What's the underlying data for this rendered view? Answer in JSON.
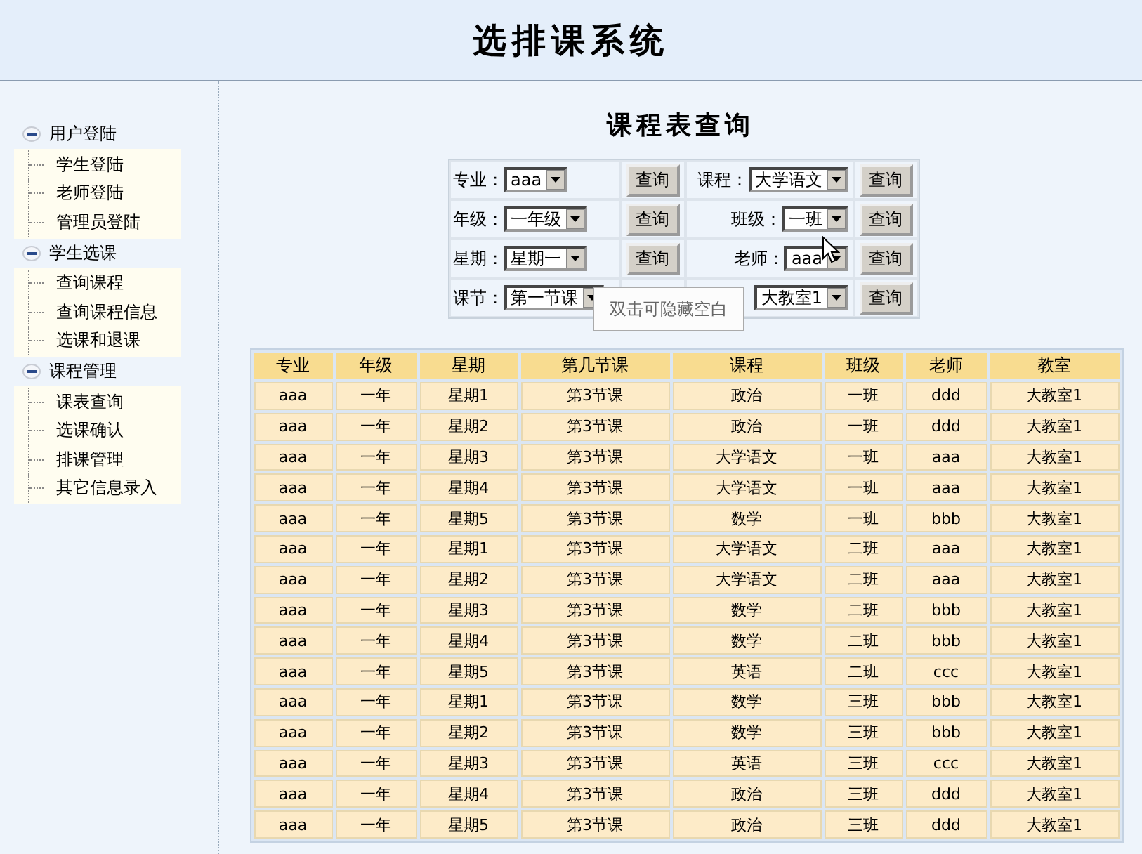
{
  "header": {
    "title": "选排课系统"
  },
  "sidebar": {
    "groups": [
      {
        "label": "用户登陆",
        "expanded": true,
        "children": [
          {
            "label": "学生登陆"
          },
          {
            "label": "老师登陆"
          },
          {
            "label": "管理员登陆"
          }
        ]
      },
      {
        "label": "学生选课",
        "expanded": true,
        "children": [
          {
            "label": "查询课程"
          },
          {
            "label": "查询课程信息"
          },
          {
            "label": "选课和退课"
          }
        ]
      },
      {
        "label": "课程管理",
        "expanded": true,
        "children": [
          {
            "label": "课表查询"
          },
          {
            "label": "选课确认"
          },
          {
            "label": "排课管理"
          },
          {
            "label": "其它信息录入"
          }
        ]
      }
    ]
  },
  "main": {
    "title": "课程表查询",
    "query_form": {
      "rows": [
        {
          "fields": [
            {
              "label": "专业：",
              "value": "aaa",
              "button": "查询"
            },
            {
              "label": "课程：",
              "value": "大学语文",
              "button": "查询"
            }
          ]
        },
        {
          "fields": [
            {
              "label": "年级：",
              "value": "一年级",
              "button": "查询"
            },
            {
              "label": "班级：",
              "value": "一班",
              "button": "查询"
            }
          ]
        },
        {
          "fields": [
            {
              "label": "星期：",
              "value": "星期一",
              "button": "查询"
            },
            {
              "label": "老师：",
              "value": "aaa",
              "button": "查询"
            }
          ]
        },
        {
          "fields": [
            {
              "label": "课节：",
              "value": "第一节课"
            },
            {
              "value": "大教室1",
              "button": "查询"
            }
          ]
        }
      ]
    },
    "tooltip": {
      "text": "双击可隐藏空白"
    },
    "table": {
      "columns": [
        "专业",
        "年级",
        "星期",
        "第几节课",
        "课程",
        "班级",
        "老师",
        "教室"
      ],
      "rows": [
        [
          "aaa",
          "一年",
          "星期1",
          "第3节课",
          "政治",
          "一班",
          "ddd",
          "大教室1"
        ],
        [
          "aaa",
          "一年",
          "星期2",
          "第3节课",
          "政治",
          "一班",
          "ddd",
          "大教室1"
        ],
        [
          "aaa",
          "一年",
          "星期3",
          "第3节课",
          "大学语文",
          "一班",
          "aaa",
          "大教室1"
        ],
        [
          "aaa",
          "一年",
          "星期4",
          "第3节课",
          "大学语文",
          "一班",
          "aaa",
          "大教室1"
        ],
        [
          "aaa",
          "一年",
          "星期5",
          "第3节课",
          "数学",
          "一班",
          "bbb",
          "大教室1"
        ],
        [
          "aaa",
          "一年",
          "星期1",
          "第3节课",
          "大学语文",
          "二班",
          "aaa",
          "大教室1"
        ],
        [
          "aaa",
          "一年",
          "星期2",
          "第3节课",
          "大学语文",
          "二班",
          "aaa",
          "大教室1"
        ],
        [
          "aaa",
          "一年",
          "星期3",
          "第3节课",
          "数学",
          "二班",
          "bbb",
          "大教室1"
        ],
        [
          "aaa",
          "一年",
          "星期4",
          "第3节课",
          "数学",
          "二班",
          "bbb",
          "大教室1"
        ],
        [
          "aaa",
          "一年",
          "星期5",
          "第3节课",
          "英语",
          "二班",
          "ccc",
          "大教室1"
        ],
        [
          "aaa",
          "一年",
          "星期1",
          "第3节课",
          "数学",
          "三班",
          "bbb",
          "大教室1"
        ],
        [
          "aaa",
          "一年",
          "星期2",
          "第3节课",
          "数学",
          "三班",
          "bbb",
          "大教室1"
        ],
        [
          "aaa",
          "一年",
          "星期3",
          "第3节课",
          "英语",
          "三班",
          "ccc",
          "大教室1"
        ],
        [
          "aaa",
          "一年",
          "星期4",
          "第3节课",
          "政治",
          "三班",
          "ddd",
          "大教室1"
        ],
        [
          "aaa",
          "一年",
          "星期5",
          "第3节课",
          "政治",
          "三班",
          "ddd",
          "大教室1"
        ]
      ]
    }
  }
}
